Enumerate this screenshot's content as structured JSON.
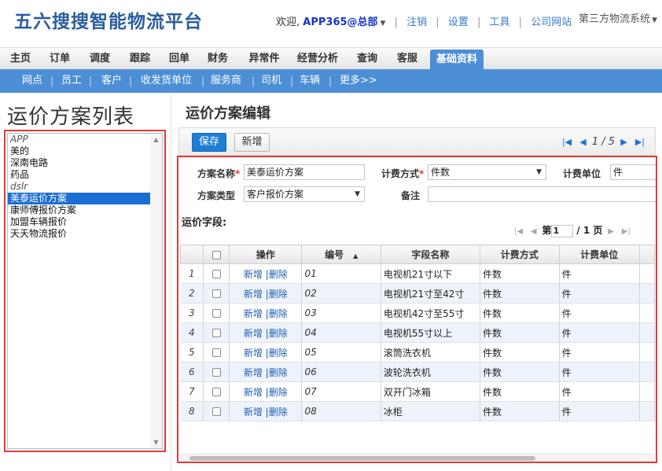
{
  "header": {
    "logo": "五六搜搜智能物流平台",
    "welcome": "欢迎,",
    "user": "APP365@总部",
    "links": [
      "注销",
      "设置",
      "工具",
      "公司网站"
    ],
    "system": "第三方物流系统"
  },
  "main_nav": [
    "主页",
    "订单",
    "调度",
    "跟踪",
    "回单",
    "财务",
    "异常件",
    "经营分析",
    "查询",
    "客服",
    "基础资料"
  ],
  "main_nav_active": "基础资料",
  "sub_nav": [
    "网点",
    "员工",
    "客户",
    "收发货单位",
    "服务商",
    "司机",
    "车辆",
    "更多>>"
  ],
  "left": {
    "title": "运价方案列表",
    "items": [
      "APP",
      "美的",
      "深南电路",
      "药品",
      "dslr",
      "美泰运价方案",
      "康师傅报价方案",
      "加盟车辆报价",
      "天天物流报价"
    ],
    "selected": "美泰运价方案"
  },
  "editor": {
    "title": "运价方案编辑",
    "save_label": "保存",
    "new_label": "新增",
    "pager": {
      "current": "1",
      "total": "/ 5"
    },
    "form": {
      "plan_name_label": "方案名称",
      "plan_name_value": "美泰运价方案",
      "billing_method_label": "计费方式",
      "billing_method_value": "件数",
      "billing_unit_label": "计费单位",
      "billing_unit_value": "件",
      "plan_type_label": "方案类型",
      "plan_type_value": "客户报价方案",
      "remark_label": "备注",
      "remark_value": "",
      "required_mark": "*"
    },
    "fields_title": "运价字段:",
    "grid_pager": {
      "prefix": "第",
      "page": "1",
      "suffix": "/ 1 页"
    },
    "columns": [
      "操作",
      "编号",
      "字段名称",
      "计费方式",
      "计费单位"
    ],
    "ops": {
      "add": "新增",
      "sep": "|",
      "del": "删除"
    },
    "rows": [
      {
        "n": "1",
        "code": "01",
        "name": "电视机21寸以下",
        "method": "件数",
        "unit": "件"
      },
      {
        "n": "2",
        "code": "02",
        "name": "电视机21寸至42寸",
        "method": "件数",
        "unit": "件"
      },
      {
        "n": "3",
        "code": "03",
        "name": "电视机42寸至55寸",
        "method": "件数",
        "unit": "件"
      },
      {
        "n": "4",
        "code": "04",
        "name": "电视机55寸以上",
        "method": "件数",
        "unit": "件"
      },
      {
        "n": "5",
        "code": "05",
        "name": "滚筒洗衣机",
        "method": "件数",
        "unit": "件"
      },
      {
        "n": "6",
        "code": "06",
        "name": "波轮洗衣机",
        "method": "件数",
        "unit": "件"
      },
      {
        "n": "7",
        "code": "07",
        "name": "双开门冰箱",
        "method": "件数",
        "unit": "件"
      },
      {
        "n": "8",
        "code": "08",
        "name": "冰柜",
        "method": "件数",
        "unit": "件"
      }
    ]
  }
}
